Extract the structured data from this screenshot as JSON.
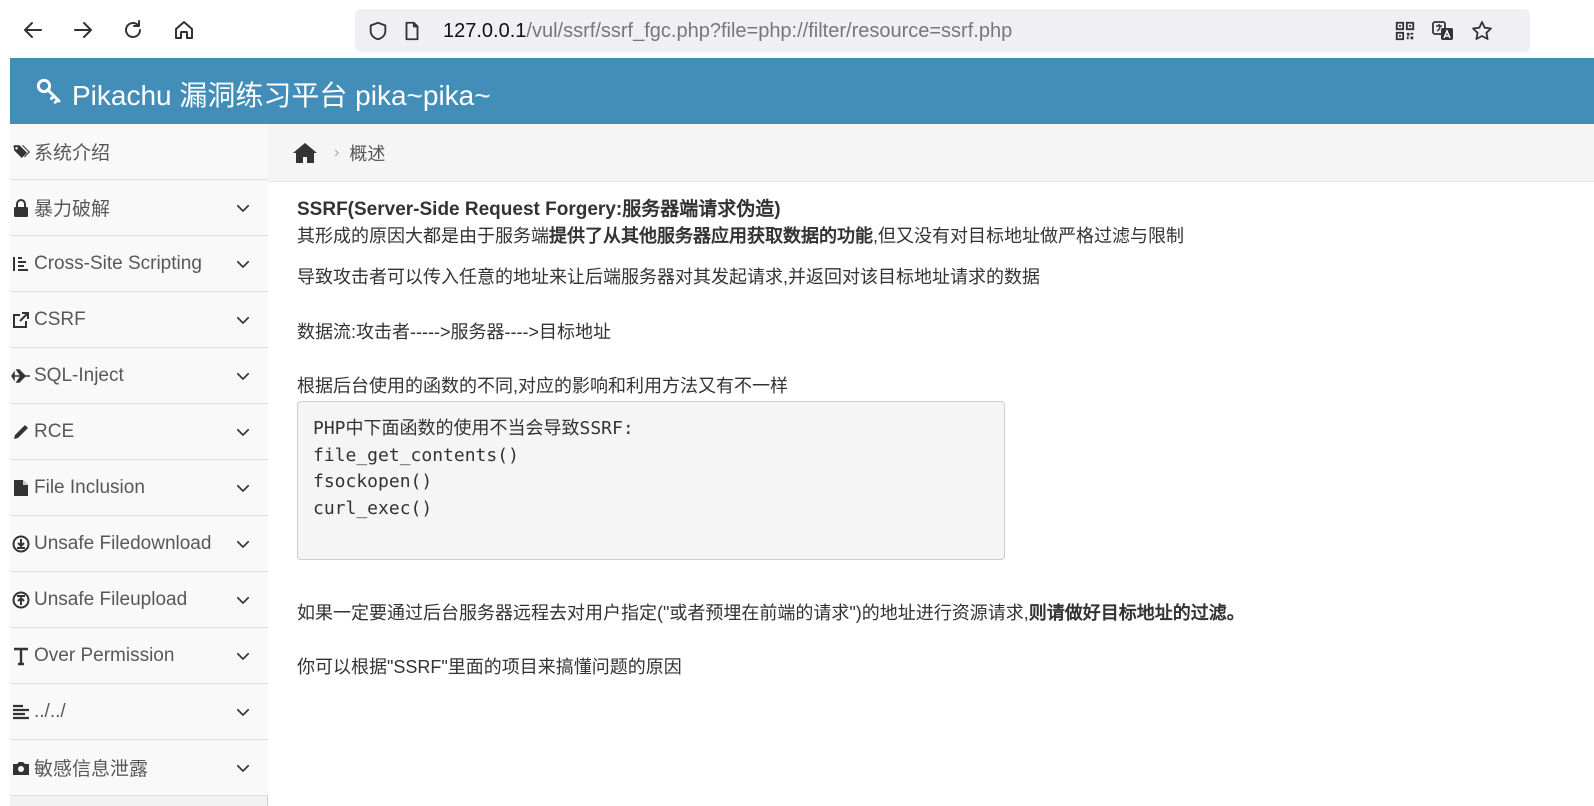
{
  "browser": {
    "url_host": "127.0.0.1",
    "url_path": "/vul/ssrf/ssrf_fgc.php?file=php://filter/resource=ssrf.php"
  },
  "header": {
    "title": "Pikachu 漏洞练习平台 pika~pika~"
  },
  "sidebar": {
    "items": [
      {
        "label": "系统介绍",
        "icon": "tags-icon"
      },
      {
        "label": "暴力破解",
        "icon": "lock-icon"
      },
      {
        "label": "Cross-Site Scripting",
        "icon": "list-icon"
      },
      {
        "label": "CSRF",
        "icon": "share-icon"
      },
      {
        "label": "SQL-Inject",
        "icon": "plane-icon"
      },
      {
        "label": "RCE",
        "icon": "pencil-icon"
      },
      {
        "label": "File Inclusion",
        "icon": "file-icon"
      },
      {
        "label": "Unsafe Filedownload",
        "icon": "download-icon"
      },
      {
        "label": "Unsafe Fileupload",
        "icon": "upload-icon"
      },
      {
        "label": "Over Permission",
        "icon": "text-icon"
      },
      {
        "label": "../../",
        "icon": "align-icon"
      },
      {
        "label": "敏感信息泄露",
        "icon": "camera-icon"
      }
    ]
  },
  "breadcrumb": {
    "current": "概述"
  },
  "content": {
    "title": "SSRF(Server-Side Request Forgery:服务器端请求伪造)",
    "p1_pre": "其形成的原因大都是由于服务端",
    "p1_bold": "提供了从其他服务器应用获取数据的功能",
    "p1_post": ",但又没有对目标地址做严格过滤与限制",
    "p2": "导致攻击者可以传入任意的地址来让后端服务器对其发起请求,并返回对该目标地址请求的数据",
    "p3": "数据流:攻击者----->服务器---->目标地址",
    "p4": "根据后台使用的函数的不同,对应的影响和利用方法又有不一样",
    "code_lines": [
      "PHP中下面函数的使用不当会导致SSRF:",
      "file_get_contents()",
      "fsockopen()",
      "curl_exec()"
    ],
    "p5_pre": "如果一定要通过后台服务器远程去对用户指定(\"或者预埋在前端的请求\")的地址进行资源请求,",
    "p5_bold": "则请做好目标地址的过滤。",
    "p6": "你可以根据\"SSRF\"里面的项目来搞懂问题的原因"
  }
}
